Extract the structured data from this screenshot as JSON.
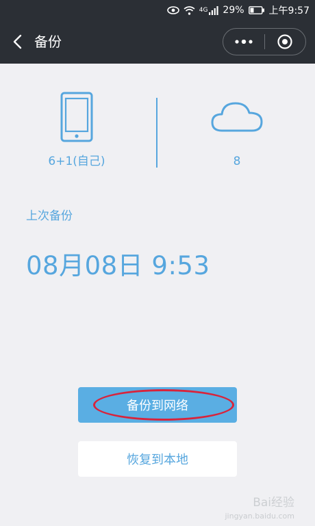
{
  "status_bar": {
    "network": "4G",
    "battery": "29%",
    "time": "上午9:57"
  },
  "nav": {
    "title": "备份"
  },
  "backup": {
    "device_count": "6+1(自己)",
    "cloud_count": "8",
    "last_backup_label": "上次备份",
    "last_backup_time": "08月08日 9:53"
  },
  "buttons": {
    "backup_to_network": "备份到网络",
    "restore_to_local": "恢复到本地"
  },
  "watermark": {
    "text": "Bai经验",
    "sub": "jingyan.baidu.com"
  },
  "colors": {
    "accent": "#56a6de",
    "primary_button": "#5aaee3",
    "header": "#2b2f35",
    "highlight": "#d8243c"
  }
}
